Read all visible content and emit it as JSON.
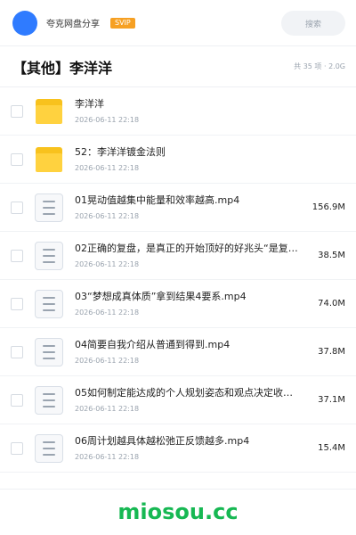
{
  "header": {
    "app_name": "夸克网盘分享",
    "badge": "SVIP",
    "search_placeholder": "搜索"
  },
  "folder": {
    "title": "【其他】李洋洋",
    "meta": "共 35 项 · 2.0G"
  },
  "items": [
    {
      "name": "李洋洋",
      "date": "2026-06-11 22:18",
      "size": "",
      "type": "folder"
    },
    {
      "name": "52：李洋洋镀金法则",
      "date": "2026-06-11 22:18",
      "size": "",
      "type": "folder"
    },
    {
      "name": "01晃动值越集中能量和效率越高.mp4",
      "date": "2026-06-11 22:18",
      "size": "156.9M",
      "type": "file"
    },
    {
      "name": "02正确的复盘，是真正的开始顶好的好兆头“是复盘能…",
      "date": "2026-06-11 22:18",
      "size": "38.5M",
      "type": "file"
    },
    {
      "name": "03“梦想成真体质”拿到结果4要系.mp4",
      "date": "2026-06-11 22:18",
      "size": "74.0M",
      "type": "file"
    },
    {
      "name": "04简要自我介绍从普通到得到.mp4",
      "date": "2026-06-11 22:18",
      "size": "37.8M",
      "type": "file"
    },
    {
      "name": "05如何制定能达成的个人规划姿态和观点决定收获.m…",
      "date": "2026-06-11 22:18",
      "size": "37.1M",
      "type": "file"
    },
    {
      "name": "06周计划越具体越松弛正反馈越多.mp4",
      "date": "2026-06-11 22:18",
      "size": "15.4M",
      "type": "file"
    }
  ],
  "watermark": "miosou.cc"
}
